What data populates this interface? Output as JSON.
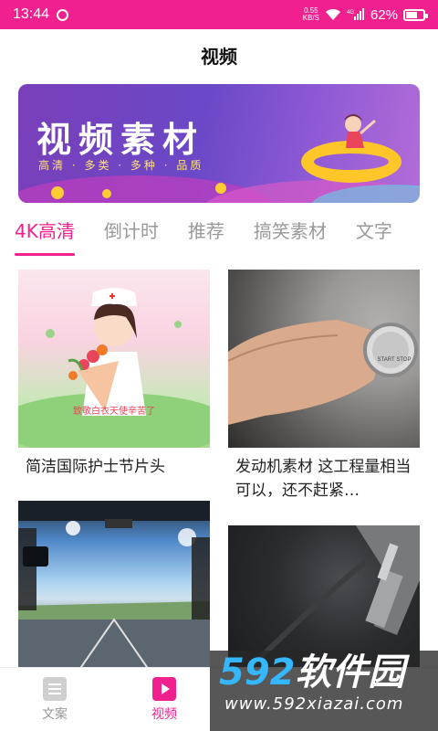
{
  "status_bar": {
    "time": "13:44",
    "net_speed_value": "0.55",
    "net_speed_unit": "KB/S",
    "network_type": "4G",
    "battery_percent": "62%",
    "battery_level": 0.62,
    "accent_color": "#f0208e"
  },
  "header": {
    "title": "视频"
  },
  "banner": {
    "title": "视频素材",
    "subtitle": "高清 · 多类 · 多种 · 品质"
  },
  "tabs": [
    {
      "label": "4K高清",
      "active": true
    },
    {
      "label": "倒计时",
      "active": false
    },
    {
      "label": "推荐",
      "active": false
    },
    {
      "label": "搞笑素材",
      "active": false
    },
    {
      "label": "文字",
      "active": false
    }
  ],
  "videos": [
    {
      "title": "简洁国际护士节片头",
      "thumb_caption": "致敬白衣天使辛苦了"
    },
    {
      "title": "发动机素材 这工程量相当可以，还不赶紧…",
      "thumb_caption": "START STOP"
    },
    {
      "title": "",
      "thumb_caption": ""
    },
    {
      "title": "",
      "thumb_caption": ""
    }
  ],
  "bottom_nav": [
    {
      "label": "文案",
      "icon": "document-icon",
      "active": false
    },
    {
      "label": "视频",
      "icon": "play-icon",
      "active": true
    }
  ],
  "watermark": {
    "top": "592软件园",
    "top_num": "592",
    "top_text": "软件园",
    "bottom": "www.592xiazai.com"
  }
}
